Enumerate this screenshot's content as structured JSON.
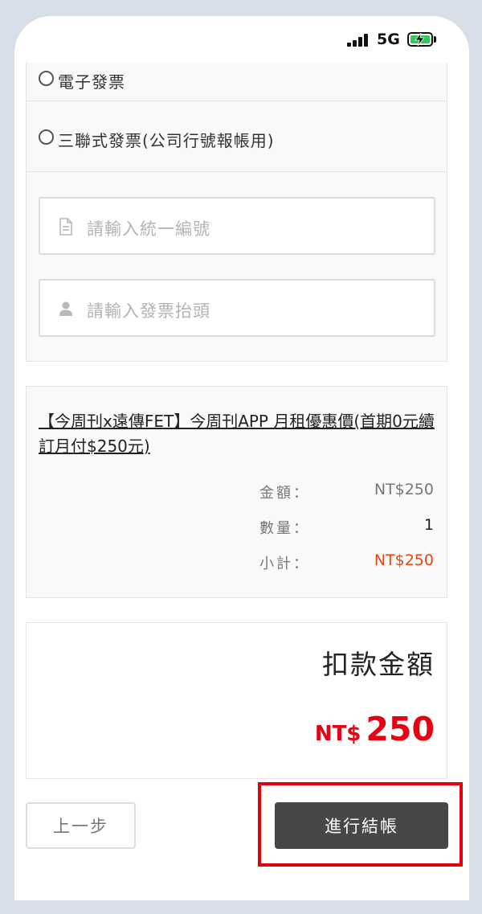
{
  "status_bar": {
    "network": "5G",
    "battery_color": "#35c759"
  },
  "invoice": {
    "options": [
      {
        "label": "電子發票"
      },
      {
        "label": "三聯式發票(公司行號報帳用)"
      }
    ],
    "tax_id_placeholder": "請輸入統一編號",
    "title_placeholder": "請輸入發票抬頭",
    "tax_id_icon": "document-icon",
    "title_icon": "user-icon"
  },
  "order": {
    "product_name": "【今周刊x遠傳FET】今周刊APP 月租優惠價(首期0元續訂月付$250元)",
    "rows": [
      {
        "label": "金額：",
        "value": "NT$250"
      },
      {
        "label": "數量：",
        "value": "1"
      },
      {
        "label": "小計：",
        "value": "NT$250"
      }
    ]
  },
  "total": {
    "title": "扣款金額",
    "currency": "NT$",
    "amount": "250",
    "accent_color": "#e60012"
  },
  "buttons": {
    "prev_label": "上一步",
    "checkout_label": "進行結帳"
  }
}
